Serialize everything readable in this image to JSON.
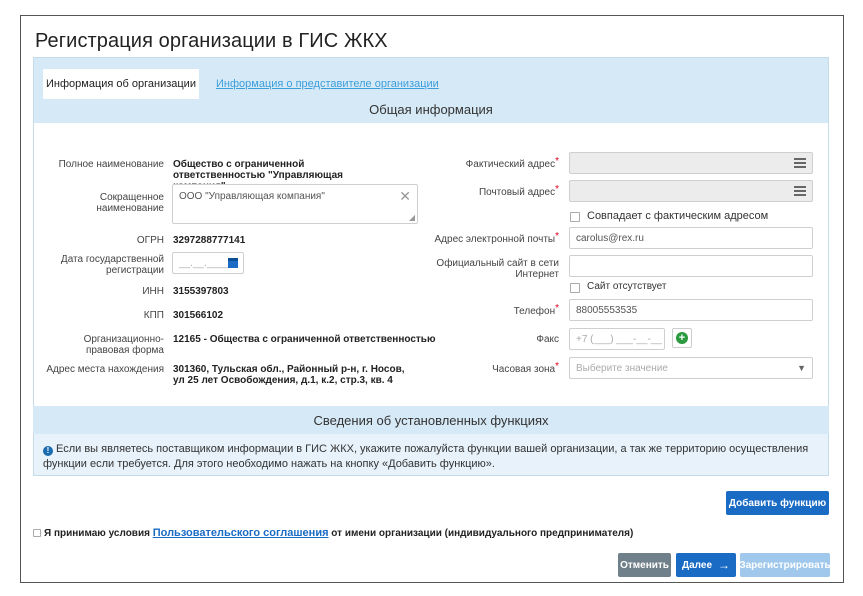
{
  "page": {
    "title": "Регистрация организации в ГИС ЖКХ"
  },
  "tabs": {
    "active": "Информация об организации",
    "link": "Информация о представителе организации"
  },
  "general": {
    "section_title": "Общая информация",
    "full_name_label": "Полное наименование",
    "full_name_value": "Общество с ограниченной ответственностью \"Управляющая компания\"",
    "short_name_label": "Сокращенное наименование",
    "short_name_value": "ООО \"Управляющая компания\"",
    "ogrn_label": "ОГРН",
    "ogrn_value": "3297288777141",
    "reg_date_label": "Дата государственной регистрации",
    "reg_date_placeholder": "__.__.____",
    "inn_label": "ИНН",
    "inn_value": "3155397803",
    "kpp_label": "КПП",
    "kpp_value": "301566102",
    "legal_form_label": "Организационно-правовая форма",
    "legal_form_value": "12165 - Общества с ограниченной ответственностью",
    "address_label": "Адрес места нахождения",
    "address_value": "301360, Тульская обл., Районный р-н, г. Носов, ул 25 лет Освобождения, д.1, к.2, стр.3, кв. 4",
    "actual_address_label": "Фактический адрес",
    "postal_address_label": "Почтовый адрес",
    "same_address_label": "Совпадает с фактическим адресом",
    "email_label": "Адрес электронной почты",
    "email_value": "carolus@rex.ru",
    "site_label": "Официальный сайт в сети Интернет",
    "no_site_label": "Сайт отсутствует",
    "phone_label": "Телефон",
    "phone_value": "88005553535",
    "fax_label": "Факс",
    "fax_placeholder": "+7 (___) ___-__-__",
    "timezone_label": "Часовая зона",
    "timezone_placeholder": "Выберите значение",
    "required_mark": "*"
  },
  "functions": {
    "title": "Сведения об установленных функциях",
    "info_text": "Если вы являетесь поставщиком информации в ГИС ЖКХ, укажите пожалуйста функции вашей организации, а так же территорию осуществления функции если требуется. Для этого необходимо нажать на кнопку «Добавить функцию».",
    "add_button": "Добавить функцию"
  },
  "agreement": {
    "prefix": "Я принимаю условия",
    "link": "Пользовательского соглашения",
    "suffix": "от имени организации (индивидуального предпринимателя)"
  },
  "footer": {
    "cancel": "Отменить",
    "next": "Далее",
    "next_arrow": "→",
    "register": "Зарегистрировать"
  },
  "colors": {
    "accent": "#1a6bc4",
    "panel_header": "#d6e9f6",
    "required": "#e0001b"
  }
}
